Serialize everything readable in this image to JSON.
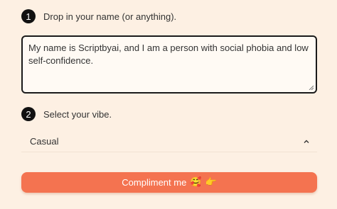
{
  "step1": {
    "number": "1",
    "label": "Drop in your name (or anything)."
  },
  "name_input": {
    "value": "My name is Scriptbyai, and I am a person with social phobia and low self-confidence."
  },
  "step2": {
    "number": "2",
    "label": "Select your vibe."
  },
  "vibe_select": {
    "selected": "Casual"
  },
  "compliment_button": {
    "label": "Compliment me",
    "emoji_1": "🥰",
    "emoji_2": "👉"
  },
  "colors": {
    "background": "#fdf0e3",
    "accent": "#f47350",
    "step_badge": "#111111"
  },
  "icons": {
    "resize": "resize-grip-icon",
    "select": "chevron-up-icon"
  }
}
